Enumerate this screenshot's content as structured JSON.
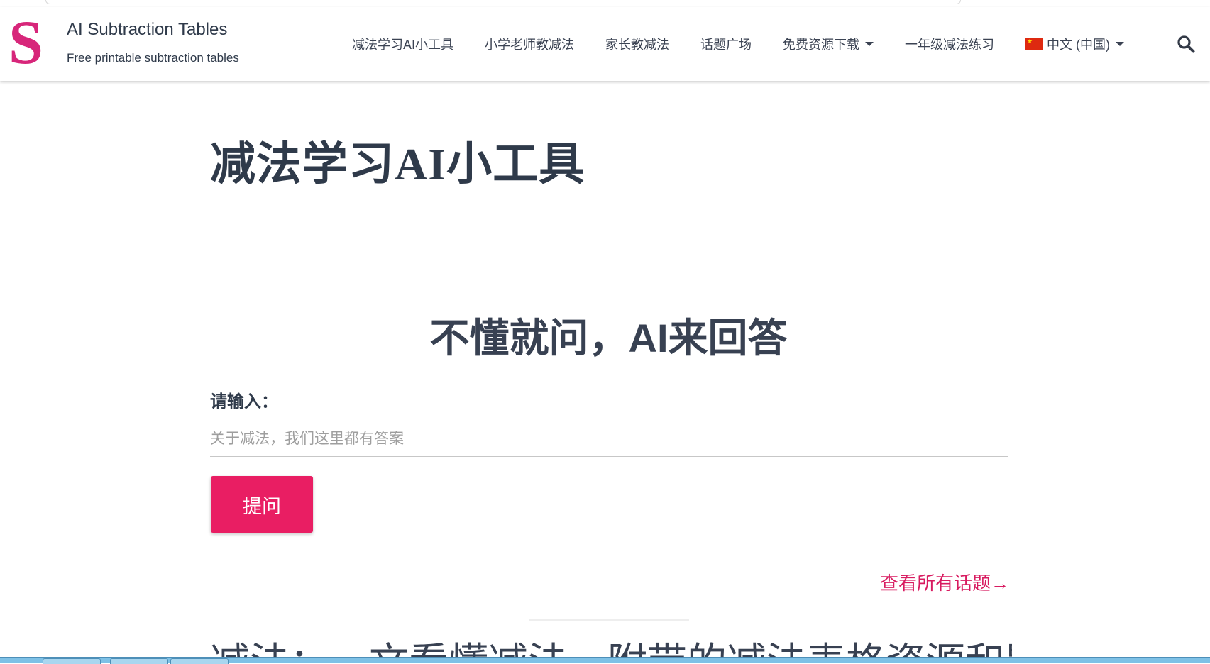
{
  "header": {
    "logo_letter": "S",
    "site_title": "AI Subtraction Tables",
    "tagline": "Free printable subtraction tables"
  },
  "nav": {
    "items": [
      {
        "label": "减法学习AI小工具"
      },
      {
        "label": "小学老师教减法"
      },
      {
        "label": "家长教减法"
      },
      {
        "label": "话题广场"
      },
      {
        "label": "免费资源下载",
        "has_dropdown": true
      },
      {
        "label": "一年级减法练习"
      }
    ],
    "language": {
      "label": "中文 (中国)",
      "flag": "china-flag-icon"
    },
    "search_icon": "search-icon"
  },
  "main": {
    "page_title": "减法学习AI小工具",
    "qa_heading": "不懂就问，AI来回答",
    "input_label": "请输入：",
    "input_placeholder": "关于减法，我们这里都有答案",
    "input_value": "",
    "ask_button": "提问",
    "all_topics_link": "查看所有话题→",
    "next_heading_partial": "减法：一文看懂减法，附带的减法表格资源和题"
  },
  "colors": {
    "accent": "#e91e63",
    "logo": "#d7267a",
    "link": "#d81b60",
    "text": "#384152"
  }
}
